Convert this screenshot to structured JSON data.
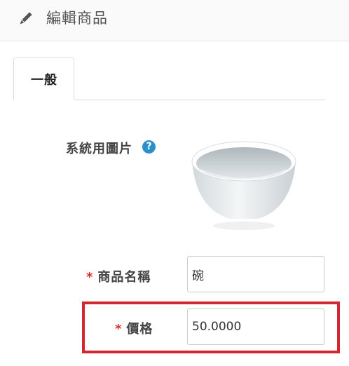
{
  "header": {
    "title": "編輯商品",
    "icon": "pencil-icon"
  },
  "tabs": [
    {
      "label": "一般",
      "active": true
    }
  ],
  "form": {
    "image_label": "系統用圖片",
    "image_help_icon": "question-circle-icon",
    "image_help_glyph": "?",
    "image_alt": "碗",
    "name_label": "商品名稱",
    "name_value": "碗",
    "price_label": "價格",
    "price_value": "50.0000",
    "required_marker": "*"
  },
  "colors": {
    "required": "#d9302a",
    "help_icon": "#2a90c8",
    "highlight": "#d22630"
  }
}
